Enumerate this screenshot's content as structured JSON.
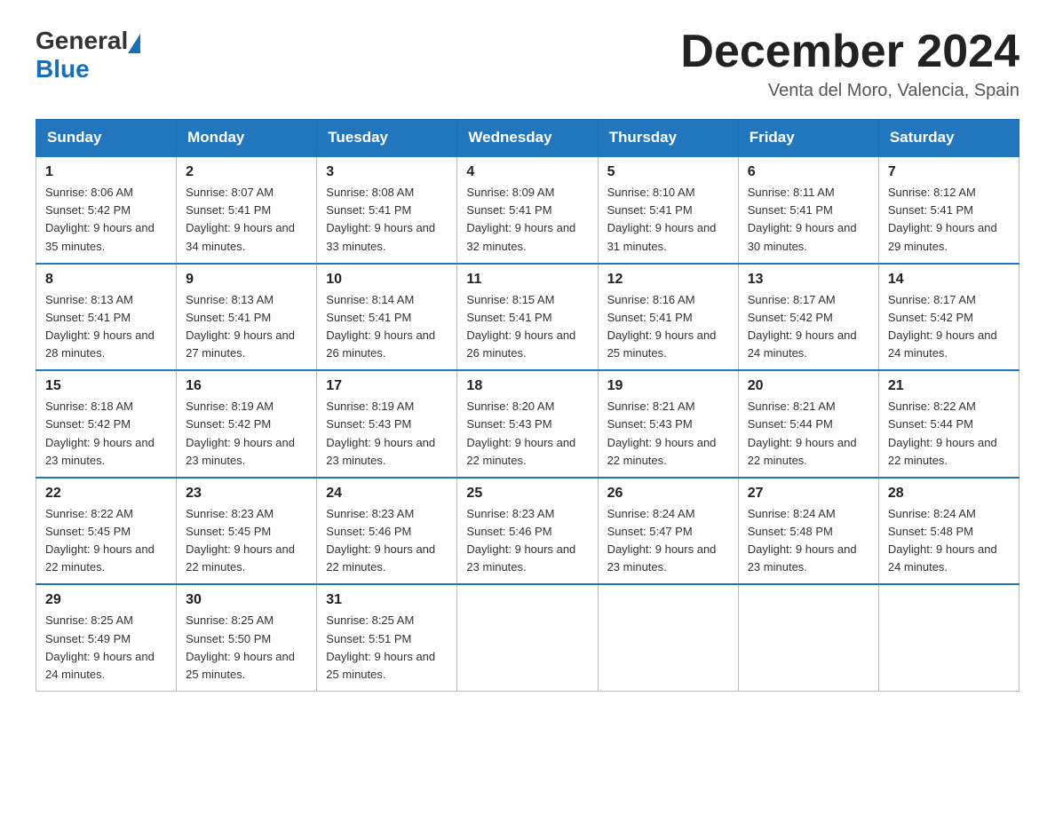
{
  "logo": {
    "general": "General",
    "blue": "Blue"
  },
  "title": "December 2024",
  "location": "Venta del Moro, Valencia, Spain",
  "days_of_week": [
    "Sunday",
    "Monday",
    "Tuesday",
    "Wednesday",
    "Thursday",
    "Friday",
    "Saturday"
  ],
  "weeks": [
    [
      {
        "day": "1",
        "sunrise": "8:06 AM",
        "sunset": "5:42 PM",
        "daylight": "9 hours and 35 minutes."
      },
      {
        "day": "2",
        "sunrise": "8:07 AM",
        "sunset": "5:41 PM",
        "daylight": "9 hours and 34 minutes."
      },
      {
        "day": "3",
        "sunrise": "8:08 AM",
        "sunset": "5:41 PM",
        "daylight": "9 hours and 33 minutes."
      },
      {
        "day": "4",
        "sunrise": "8:09 AM",
        "sunset": "5:41 PM",
        "daylight": "9 hours and 32 minutes."
      },
      {
        "day": "5",
        "sunrise": "8:10 AM",
        "sunset": "5:41 PM",
        "daylight": "9 hours and 31 minutes."
      },
      {
        "day": "6",
        "sunrise": "8:11 AM",
        "sunset": "5:41 PM",
        "daylight": "9 hours and 30 minutes."
      },
      {
        "day": "7",
        "sunrise": "8:12 AM",
        "sunset": "5:41 PM",
        "daylight": "9 hours and 29 minutes."
      }
    ],
    [
      {
        "day": "8",
        "sunrise": "8:13 AM",
        "sunset": "5:41 PM",
        "daylight": "9 hours and 28 minutes."
      },
      {
        "day": "9",
        "sunrise": "8:13 AM",
        "sunset": "5:41 PM",
        "daylight": "9 hours and 27 minutes."
      },
      {
        "day": "10",
        "sunrise": "8:14 AM",
        "sunset": "5:41 PM",
        "daylight": "9 hours and 26 minutes."
      },
      {
        "day": "11",
        "sunrise": "8:15 AM",
        "sunset": "5:41 PM",
        "daylight": "9 hours and 26 minutes."
      },
      {
        "day": "12",
        "sunrise": "8:16 AM",
        "sunset": "5:41 PM",
        "daylight": "9 hours and 25 minutes."
      },
      {
        "day": "13",
        "sunrise": "8:17 AM",
        "sunset": "5:42 PM",
        "daylight": "9 hours and 24 minutes."
      },
      {
        "day": "14",
        "sunrise": "8:17 AM",
        "sunset": "5:42 PM",
        "daylight": "9 hours and 24 minutes."
      }
    ],
    [
      {
        "day": "15",
        "sunrise": "8:18 AM",
        "sunset": "5:42 PM",
        "daylight": "9 hours and 23 minutes."
      },
      {
        "day": "16",
        "sunrise": "8:19 AM",
        "sunset": "5:42 PM",
        "daylight": "9 hours and 23 minutes."
      },
      {
        "day": "17",
        "sunrise": "8:19 AM",
        "sunset": "5:43 PM",
        "daylight": "9 hours and 23 minutes."
      },
      {
        "day": "18",
        "sunrise": "8:20 AM",
        "sunset": "5:43 PM",
        "daylight": "9 hours and 22 minutes."
      },
      {
        "day": "19",
        "sunrise": "8:21 AM",
        "sunset": "5:43 PM",
        "daylight": "9 hours and 22 minutes."
      },
      {
        "day": "20",
        "sunrise": "8:21 AM",
        "sunset": "5:44 PM",
        "daylight": "9 hours and 22 minutes."
      },
      {
        "day": "21",
        "sunrise": "8:22 AM",
        "sunset": "5:44 PM",
        "daylight": "9 hours and 22 minutes."
      }
    ],
    [
      {
        "day": "22",
        "sunrise": "8:22 AM",
        "sunset": "5:45 PM",
        "daylight": "9 hours and 22 minutes."
      },
      {
        "day": "23",
        "sunrise": "8:23 AM",
        "sunset": "5:45 PM",
        "daylight": "9 hours and 22 minutes."
      },
      {
        "day": "24",
        "sunrise": "8:23 AM",
        "sunset": "5:46 PM",
        "daylight": "9 hours and 22 minutes."
      },
      {
        "day": "25",
        "sunrise": "8:23 AM",
        "sunset": "5:46 PM",
        "daylight": "9 hours and 23 minutes."
      },
      {
        "day": "26",
        "sunrise": "8:24 AM",
        "sunset": "5:47 PM",
        "daylight": "9 hours and 23 minutes."
      },
      {
        "day": "27",
        "sunrise": "8:24 AM",
        "sunset": "5:48 PM",
        "daylight": "9 hours and 23 minutes."
      },
      {
        "day": "28",
        "sunrise": "8:24 AM",
        "sunset": "5:48 PM",
        "daylight": "9 hours and 24 minutes."
      }
    ],
    [
      {
        "day": "29",
        "sunrise": "8:25 AM",
        "sunset": "5:49 PM",
        "daylight": "9 hours and 24 minutes."
      },
      {
        "day": "30",
        "sunrise": "8:25 AM",
        "sunset": "5:50 PM",
        "daylight": "9 hours and 25 minutes."
      },
      {
        "day": "31",
        "sunrise": "8:25 AM",
        "sunset": "5:51 PM",
        "daylight": "9 hours and 25 minutes."
      },
      null,
      null,
      null,
      null
    ]
  ]
}
